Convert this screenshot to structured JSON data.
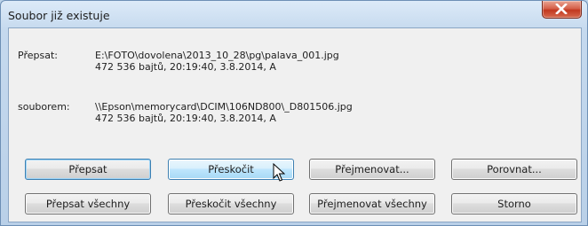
{
  "window": {
    "title": "Soubor již existuje",
    "close_icon": "close-icon"
  },
  "overwrite": {
    "label": "Přepsat:",
    "path": "E:\\FOTO\\dovolena\\2013_10_28\\pg\\palava_001.jpg",
    "details": "472 536 bajtů, 20:19:40, 3.8.2014, A"
  },
  "source": {
    "label": "souborem:",
    "path": "\\\\Epson\\memorycard\\DCIM\\106ND800\\_D801506.jpg",
    "details": "472 536 bajtů, 20:19:40, 3.8.2014, A"
  },
  "buttons": {
    "overwrite": "Přepsat",
    "skip": "Přeskočit",
    "rename": "Přejmenovat...",
    "compare": "Porovnat...",
    "overwrite_all": "Přepsat všechny",
    "skip_all": "Přeskočit všechny",
    "rename_all": "Přejmenovat všechny",
    "cancel": "Storno"
  }
}
